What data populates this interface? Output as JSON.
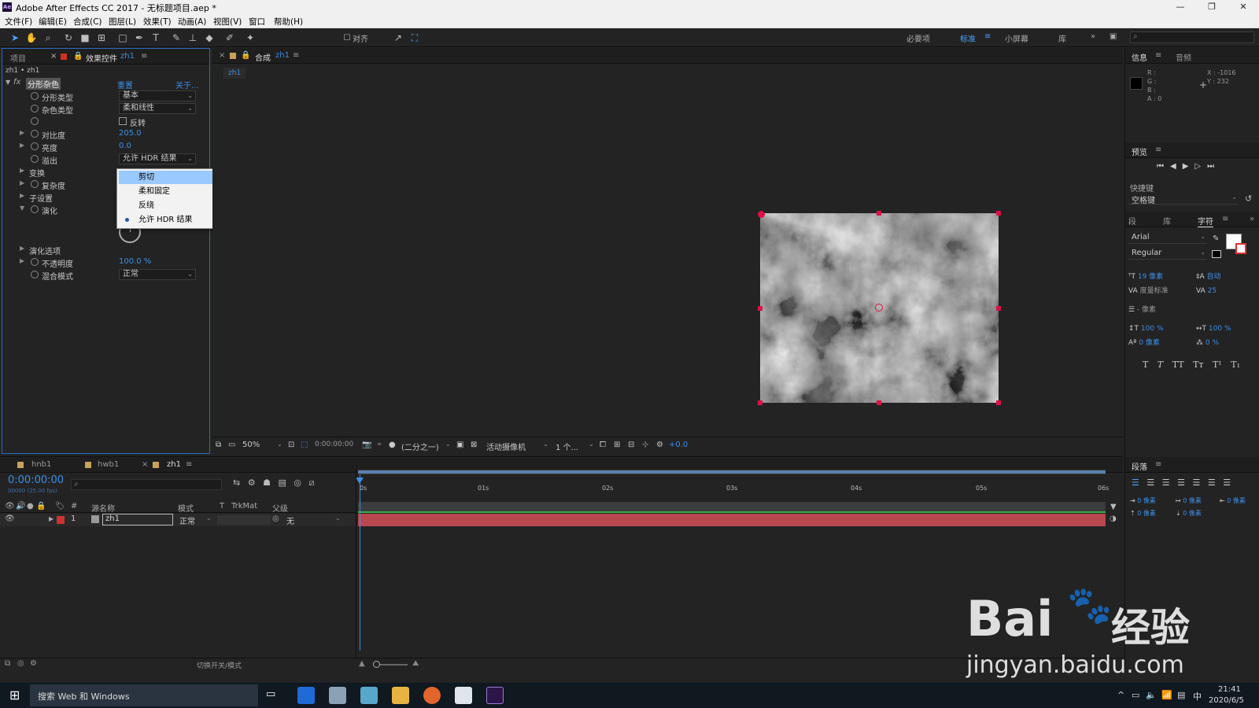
{
  "window": {
    "title": "Adobe After Effects CC 2017 - 无标题项目.aep *",
    "app_icon": "Ae",
    "controls": [
      "—",
      "❐",
      "✕"
    ]
  },
  "menu": [
    "文件(F)",
    "编辑(E)",
    "合成(C)",
    "图层(L)",
    "效果(T)",
    "动画(A)",
    "视图(V)",
    "窗口",
    "帮助(H)"
  ],
  "toolbar": {
    "align_label": "对齐",
    "workspaces": [
      "必要项",
      "标准",
      "小屏幕",
      "库"
    ],
    "active_workspace": "标准"
  },
  "project_panel": {
    "tab_project": "项目",
    "tab_effects": "效果控件",
    "tab_effects_layer": "zh1",
    "breadcrumb": "zh1 • zh1"
  },
  "effect": {
    "name": "分形杂色",
    "reset": "重置",
    "about": "关于...",
    "rows": {
      "fractal_type": {
        "label": "分形类型",
        "value": "基本"
      },
      "noise_type": {
        "label": "杂色类型",
        "value": "柔和线性"
      },
      "invert": {
        "label": "反转"
      },
      "contrast": {
        "label": "对比度",
        "value": "205.0"
      },
      "brightness": {
        "label": "亮度",
        "value": "0.0"
      },
      "overflow": {
        "label": "溢出",
        "value": "允许 HDR 结果"
      },
      "transform": {
        "label": "变换"
      },
      "complexity": {
        "label": "复杂度"
      },
      "sub_settings": {
        "label": "子设置"
      },
      "evolution": {
        "label": "演化"
      },
      "evolution_options": {
        "label": "演化选项"
      },
      "opacity": {
        "label": "不透明度",
        "value": "100.0 %"
      },
      "blend_mode": {
        "label": "混合模式",
        "value": "正常"
      }
    }
  },
  "overflow_menu": {
    "items": [
      "剪切",
      "柔和固定",
      "反绕",
      "允许 HDR 结果"
    ],
    "highlighted": "剪切",
    "selected": "允许 HDR 结果"
  },
  "composition": {
    "tab_label": "合成",
    "tab_name": "zh1",
    "subtab": "zh1",
    "zoom": "50%",
    "timecode": "0:00:00:00",
    "resolution": "(二分之一)",
    "camera": "活动摄像机",
    "views": "1 个...",
    "exposure": "+0.0"
  },
  "info_panel": {
    "tab_info": "信息",
    "tab_audio": "音频",
    "r": "R :",
    "g": "G :",
    "b": "B :",
    "a": "A : 0",
    "x": "X : -1016",
    "y": "Y : 232"
  },
  "preview_panel": {
    "title": "预览",
    "shortcut_label": "快捷键",
    "shortcut_value": "空格键"
  },
  "character_panel": {
    "tab_1": "段",
    "tab_2": "库",
    "tab_3": "字符",
    "font": "Arial",
    "style": "Regular",
    "size": "19 像素",
    "leading": "自动",
    "kerning": "度量标准",
    "tracking": "25",
    "stroke": "- 像素",
    "vscale": "100 %",
    "hscale": "100 %",
    "baseline": "0 像素",
    "tsume": "0 %",
    "styles": [
      "T",
      "T",
      "TT",
      "Tт",
      "T¹",
      "T₁"
    ]
  },
  "paragraph_panel": {
    "title": "段落",
    "indent_left": "0 像素",
    "indent_first": "0 像素",
    "indent_right": "0 像素",
    "space_before": "0 像素",
    "space_after": "0 像素"
  },
  "timeline": {
    "tabs": [
      "hnb1",
      "hwb1",
      "zh1"
    ],
    "active_tab": "zh1",
    "timecode": "0:00:00:00",
    "fps": "00000 (25.00 fps)",
    "columns": {
      "num": "#",
      "source": "源名称",
      "mode": "模式",
      "t": "T",
      "trkmat": "TrkMat",
      "parent": "父级"
    },
    "ruler": [
      "0s",
      "01s",
      "02s",
      "03s",
      "04s",
      "05s",
      "06s"
    ],
    "layer": {
      "num": "1",
      "name": "zh1",
      "mode": "正常",
      "parent": "无"
    },
    "footer": "切换开关/模式"
  },
  "taskbar": {
    "search": "搜索 Web 和 Windows",
    "time": "21:41",
    "date": "2020/6/5",
    "ime": "中"
  },
  "watermark": {
    "logo": "Bai",
    "logo_cn": "经验",
    "url": "jingyan.baidu.com"
  },
  "colors": {
    "accent": "#3d8ee6",
    "layer_bar": "#b8474f",
    "panel_bg": "#232323"
  }
}
